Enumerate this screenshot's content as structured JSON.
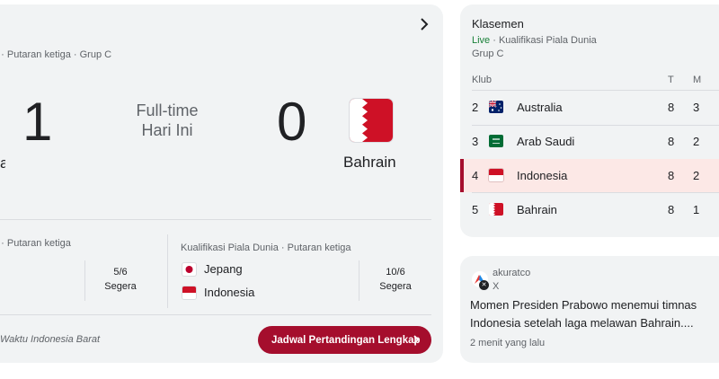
{
  "match": {
    "competition": "a · Putaran ketiga · Grup C",
    "home_score": "1",
    "away_score": "0",
    "status_line1": "Full-time",
    "status_line2": "Hari Ini",
    "home_name_partial": "a",
    "away_name": "Bahrain"
  },
  "upcoming": [
    {
      "competition": "a · Putaran ketiga",
      "date_line1": "5/6",
      "date_line2": "Segera"
    },
    {
      "competition": "Kualifikasi Piala Dunia · Putaran ketiga",
      "team1": "Jepang",
      "team2": "Indonesia",
      "date_line1": "10/6",
      "date_line2": "Segera"
    }
  ],
  "footer": {
    "timezone": "Waktu Indonesia Barat",
    "button_label": "Jadwal Pertandingan Lengkap"
  },
  "standings": {
    "title": "Klasemen",
    "live_label": "Live",
    "subtitle_rest": " · Kualifikasi Piala Dunia",
    "group": "Grup C",
    "columns": {
      "club": "Klub",
      "played": "T",
      "won": "M"
    },
    "rows": [
      {
        "rank": "2",
        "team": "Australia",
        "played": "8",
        "won": "3"
      },
      {
        "rank": "3",
        "team": "Arab Saudi",
        "played": "8",
        "won": "2"
      },
      {
        "rank": "4",
        "team": "Indonesia",
        "played": "8",
        "won": "2"
      },
      {
        "rank": "5",
        "team": "Bahrain",
        "played": "8",
        "won": "1"
      }
    ]
  },
  "news": {
    "source": "akuratco",
    "platform": "X",
    "headline": "Momen Presiden Prabowo menemui timnas Indonesia setelah laga melawan Bahrain....",
    "time": "2 menit yang lalu"
  },
  "colors": {
    "accent": "#a50e2d",
    "live": "#188038",
    "highlight_row": "#fce8e6",
    "card_bg": "#f1f3f4"
  }
}
